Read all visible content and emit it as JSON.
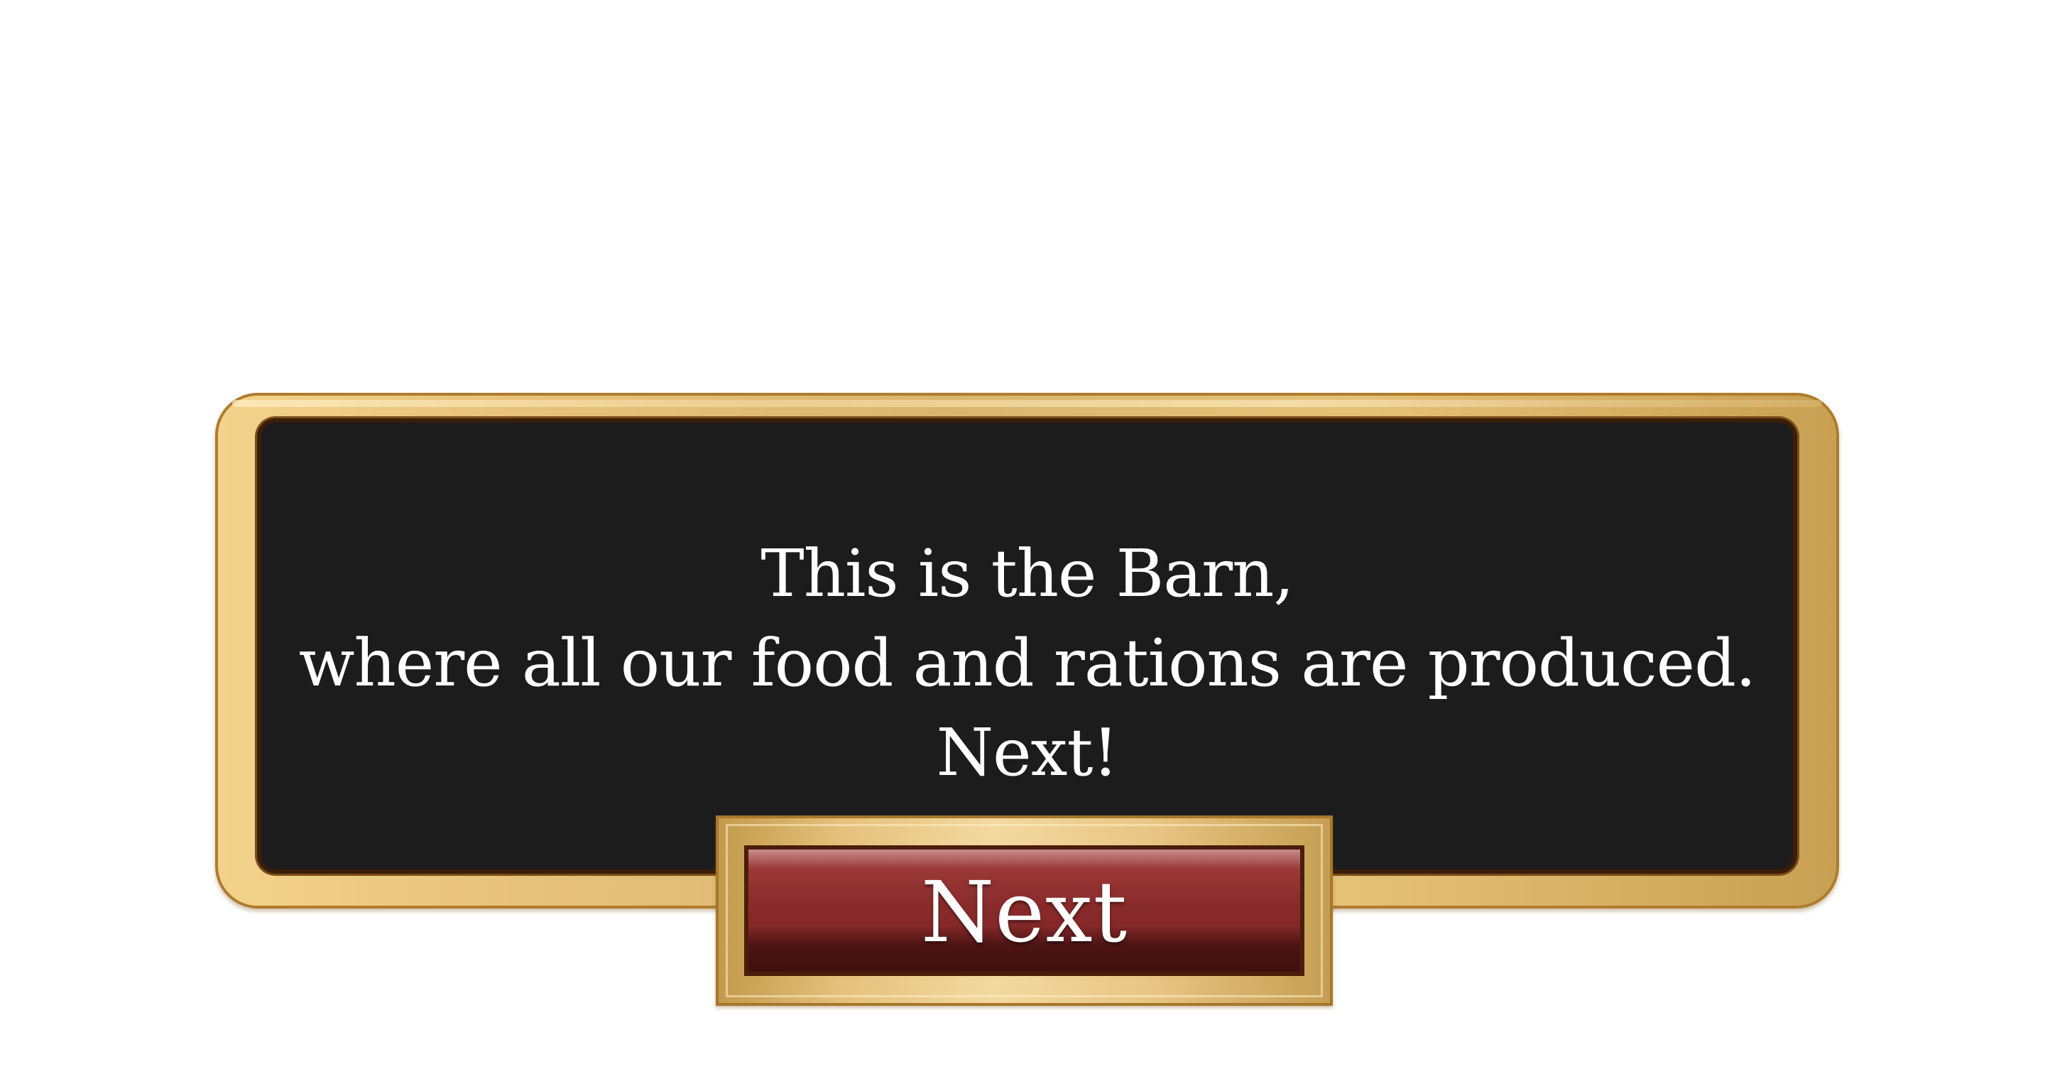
{
  "dialog": {
    "lines": [
      "This is the Barn,",
      "where all our food and rations are produced.",
      "Next!"
    ]
  },
  "buttons": {
    "next_label": "Next"
  },
  "colors": {
    "panel_background": "#1c1c1c",
    "frame_gold": "#e5c178",
    "button_red": "#8a2a2a",
    "text": "#ffffff"
  }
}
